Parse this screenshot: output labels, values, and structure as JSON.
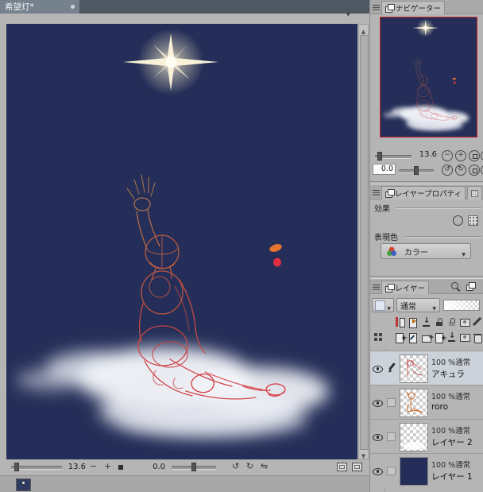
{
  "document": {
    "tab_title": "希望灯*",
    "zoom_value": "13.6",
    "rotation_value": "0.0"
  },
  "navigator": {
    "title": "ナビゲーター",
    "zoom_value": "13.6",
    "rotation_value": "0.0"
  },
  "layer_property": {
    "title": "レイヤープロパティ",
    "effect_label": "効果",
    "expression_color_label": "表現色",
    "color_mode_value": "カラー"
  },
  "layers_panel": {
    "title": "レイヤー",
    "blend_mode_value": "通常",
    "rows": [
      {
        "info": "100 %通常",
        "name": "アキュラ"
      },
      {
        "info": "100 %通常",
        "name": "roro"
      },
      {
        "info": "100 %通常",
        "name": "レイヤー 2"
      },
      {
        "info": "100 %通常",
        "name": "レイヤー 1"
      }
    ]
  },
  "icons": {
    "caret_down": "▼",
    "scroll_up": "▲",
    "scroll_down": "▼",
    "zoom_out": "−",
    "zoom_in": "+",
    "rotate_left": "↺",
    "rotate_right": "↻",
    "flip_horizontal": "⇋",
    "transfer_down": "↓",
    "add": "+"
  },
  "colors": {
    "canvas_bg": "#242e58",
    "panel_bg": "#b5b5b5",
    "tabbar_bg": "#4d5863",
    "navigator_view_border": "#cc2626",
    "sketch_warm": "#b06a47",
    "sketch_red": "#d23f42",
    "blob_orange": "#e5722d",
    "blob_red": "#de2f40",
    "star_color": "#f9f2d8"
  }
}
